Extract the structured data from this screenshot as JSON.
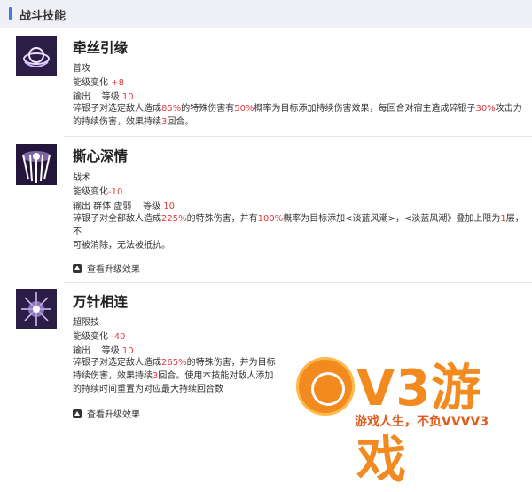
{
  "header": {
    "title": "战斗技能"
  },
  "skills": [
    {
      "name": "牵丝引缘",
      "type": "普攻",
      "energy_label": "能级变化",
      "energy_value": "+8",
      "tags": "输出",
      "level_label": "等级",
      "level_value": "10",
      "desc": [
        "碎银子对选定敌人造成",
        "85%",
        "的特殊伤害有",
        "50%",
        "概率为目标添加持续伤害效果，每回合对宿主造成碎银子",
        "30%",
        "攻击力",
        "的持续伤害，效果持续",
        "3",
        "回合。"
      ]
    },
    {
      "name": "撕心深情",
      "type": "战术",
      "energy_label": "能级变化",
      "energy_value": "-10",
      "tags": "输出 群体 虚弱",
      "level_label": "等级",
      "level_value": "10",
      "desc": [
        "碎银子对全部敌人造成",
        "225%",
        "的特殊伤害，并有",
        "100%",
        "概率为目标添加<淡蓝风潮>，<淡蓝风潮》叠加上限为",
        "1",
        "层，不",
        "可被消除，无法被抵抗。"
      ],
      "upgrade": "查看升级效果"
    },
    {
      "name": "万针相连",
      "type": "超限技",
      "energy_label": "能级变化",
      "energy_value": "-40",
      "tags": "输出",
      "level_label": "等级",
      "level_value": "10",
      "desc": [
        "碎银子对选定敌人造成",
        "265%",
        "的特殊伤害，并为目标",
        "持续伤害，效果持续",
        "3",
        "回合。使用本技能对敌人添加",
        "的持续时间重置为对应最大持续回合数"
      ],
      "upgrade": "查看升级效果"
    }
  ],
  "watermark": {
    "logo": "V3游戏",
    "tagline": "游戏人生，不负VVVV3"
  }
}
